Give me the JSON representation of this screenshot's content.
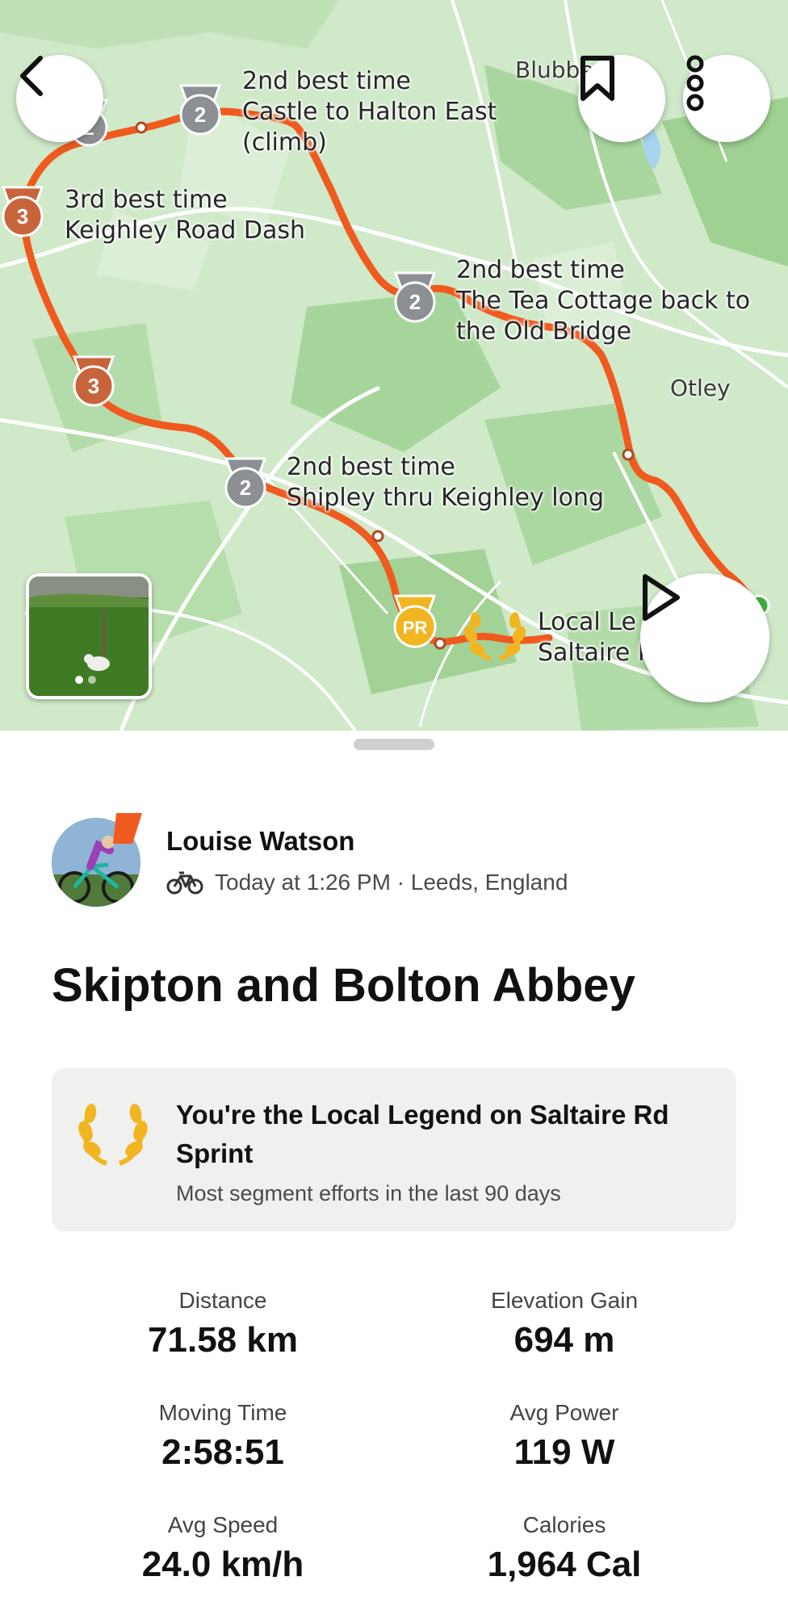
{
  "map": {
    "labels": {
      "castle": [
        "2nd best time",
        "Castle to Halton East",
        "(climb)"
      ],
      "keighley_road": [
        "3rd best time",
        "Keighley Road Dash"
      ],
      "tea_cottage": [
        "2nd best time",
        "The Tea Cottage back to",
        "the Old Bridge"
      ],
      "shipley": [
        "2nd best time",
        "Shipley thru Keighley long"
      ],
      "local_legend": [
        "Local Le",
        "Saltaire R"
      ]
    },
    "places": {
      "blubberhouses": "Blubbe   es",
      "otley": "Otley"
    },
    "medals": {
      "castle_rank": "2",
      "near_castle_rank": "2",
      "keighley_road_rank": "3",
      "mid_rank": "3",
      "tea_cottage_rank": "2",
      "shipley_rank": "2",
      "pr": "PR"
    },
    "colors": {
      "route": "#f05a1e",
      "silver": "#8c8f94",
      "bronze": "#c8643c",
      "gold": "#f2b522"
    }
  },
  "buttons": {
    "back_icon": "chevron-left-icon",
    "save_icon": "bookmark-icon",
    "more_icon": "more-vertical-icon",
    "play_icon": "play-icon"
  },
  "athlete": {
    "name": "Louise Watson",
    "activity_icon": "bike-icon",
    "meta": "Today at 1:26 PM · Leeds, England"
  },
  "activity": {
    "title": "Skipton and Bolton Abbey"
  },
  "legend_card": {
    "title": "You're the Local Legend on Saltaire Rd Sprint",
    "subtitle": "Most segment efforts in the last 90 days"
  },
  "stats": [
    {
      "label": "Distance",
      "value": "71.58 km"
    },
    {
      "label": "Elevation Gain",
      "value": "694 m"
    },
    {
      "label": "Moving Time",
      "value": "2:58:51"
    },
    {
      "label": "Avg Power",
      "value": "119 W"
    },
    {
      "label": "Avg Speed",
      "value": "24.0 km/h"
    },
    {
      "label": "Calories",
      "value": "1,964 Cal"
    }
  ]
}
